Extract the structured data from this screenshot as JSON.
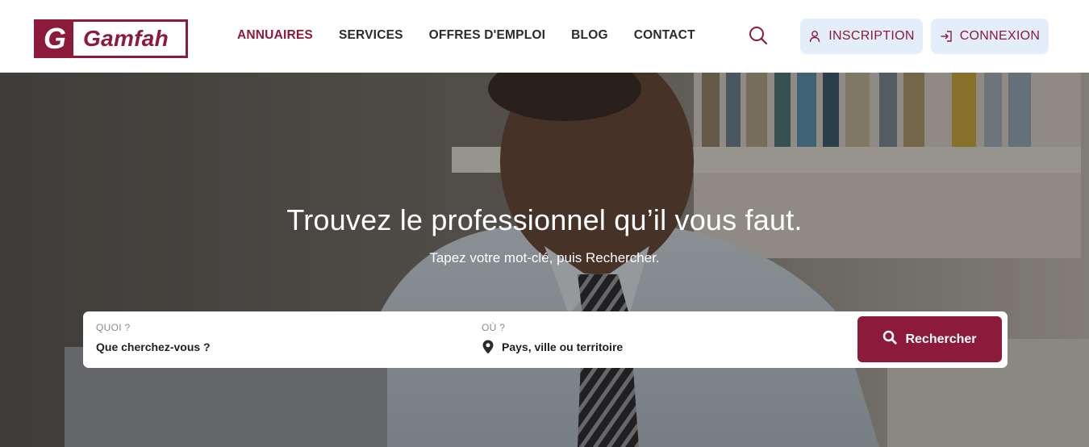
{
  "brand": {
    "logo_mark": "G",
    "logo_text": "Gamfah",
    "color": "#8b1a3b"
  },
  "nav": {
    "items": [
      {
        "label": "ANNUAIRES",
        "active": true
      },
      {
        "label": "SERVICES",
        "active": false
      },
      {
        "label": "OFFRES D'EMPLOI",
        "active": false
      },
      {
        "label": "BLOG",
        "active": false
      },
      {
        "label": "CONTACT",
        "active": false
      }
    ],
    "search_icon": "search-icon"
  },
  "auth": {
    "signup_label": "INSCRIPTION",
    "signup_icon": "user-icon",
    "login_label": "CONNEXION",
    "login_icon": "sign-in-icon",
    "button_bg": "#e3eefa"
  },
  "hero": {
    "title": "Trouvez le professionnel qu’il vous faut.",
    "subtitle": "Tapez votre mot-clé, puis Rechercher."
  },
  "search": {
    "what_label": "QUOI ?",
    "what_placeholder": "Que cherchez-vous ?",
    "where_label": "OÙ ?",
    "where_icon": "map-pin-icon",
    "where_placeholder": "Pays, ville ou territoire",
    "button_label": "Rechercher",
    "button_icon": "search-icon"
  }
}
